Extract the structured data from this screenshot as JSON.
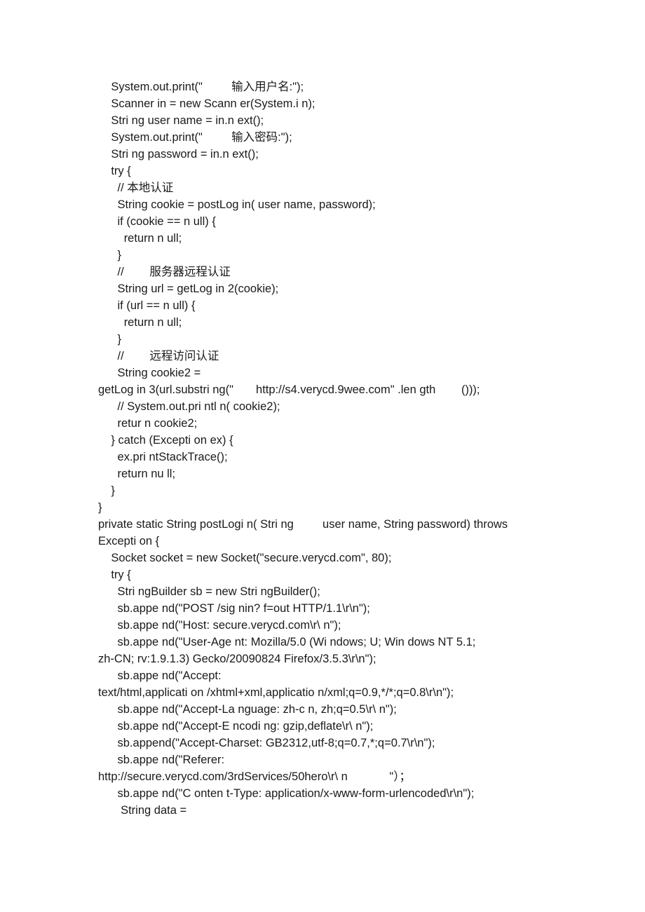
{
  "code": "    System.out.print(\"         输入用户名:\");\n    Scanner in = new Scann er(System.i n);\n    Stri ng user name = in.n ext();\n    System.out.print(\"         输入密码:\");\n    Stri ng password = in.n ext();\n    try {\n      // 本地认证\n      String cookie = postLog in( user name, password);\n      if (cookie == n ull) {\n        return n ull;\n      }\n      //        服务器远程认证\n      String url = getLog in 2(cookie);\n      if (url == n ull) {\n        return n ull;\n      }\n      //        远程访问认证\n      String cookie2 =\ngetLog in 3(url.substri ng(\"       http://s4.verycd.9wee.com\" .len gth        ()));\n      // System.out.pri ntl n( cookie2);\n      retur n cookie2;\n    } catch (Excepti on ex) {\n      ex.pri ntStackTrace();\n      return nu ll;\n    }\n}\nprivate static String postLogi n( Stri ng         user name, String password) throws\nExcepti on {\n    Socket socket = new Socket(\"secure.verycd.com\", 80);\n    try {\n      Stri ngBuilder sb = new Stri ngBuilder();\n      sb.appe nd(\"POST /sig nin? f=out HTTP/1.1\\r\\n\");\n      sb.appe nd(\"Host: secure.verycd.com\\r\\ n\");\n      sb.appe nd(\"User-Age nt: Mozilla/5.0 (Wi ndows; U; Win dows NT 5.1;\nzh-CN; rv:1.9.1.3) Gecko/20090824 Firefox/3.5.3\\r\\n\");\n      sb.appe nd(\"Accept:\ntext/html,applicati on /xhtml+xml,applicatio n/xml;q=0.9,*/*;q=0.8\\r\\n\");\n      sb.appe nd(\"Accept-La nguage: zh-c n, zh;q=0.5\\r\\ n\");\n      sb.appe nd(\"Accept-E ncodi ng: gzip,deflate\\r\\ n\");\n      sb.append(\"Accept-Charset: GB2312,utf-8;q=0.7,*;q=0.7\\r\\n\");\n      sb.appe nd(\"Referer:\nhttp://secure.verycd.com/3rdServices/50hero\\r\\ n             \"）；\n      sb.appe nd(\"C onten t-Type: application/x-www-form-urlencoded\\r\\n\");\n       String data ="
}
